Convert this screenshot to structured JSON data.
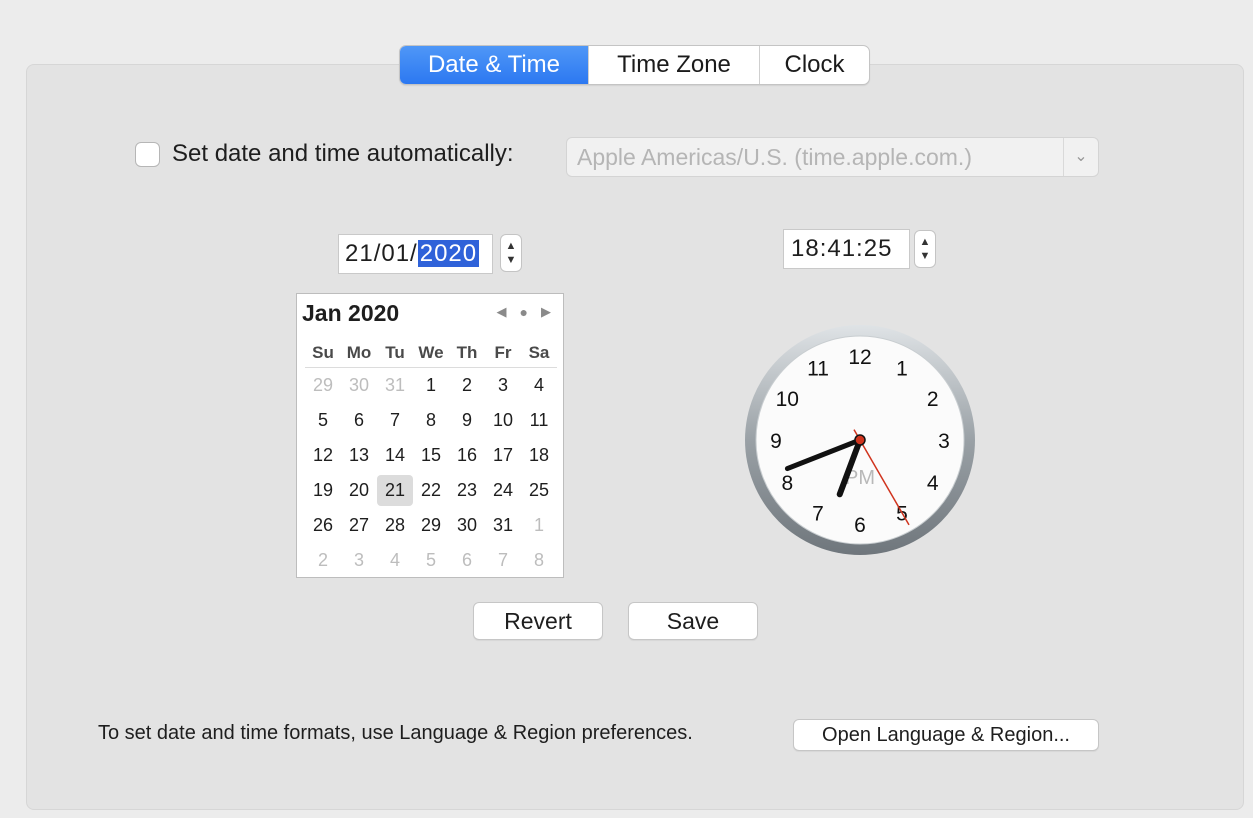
{
  "tabs": [
    {
      "label": "Date & Time",
      "active": true
    },
    {
      "label": "Time Zone",
      "active": false
    },
    {
      "label": "Clock",
      "active": false
    }
  ],
  "auto_time": {
    "checked": false,
    "label": "Set date and time automatically:",
    "server": "Apple Americas/U.S. (time.apple.com.)"
  },
  "date_field": {
    "day_month": "21/01/",
    "year": "2020"
  },
  "time_field": {
    "value": "18:41:25"
  },
  "calendar": {
    "title": "Jan 2020",
    "nav": {
      "prev": "◀",
      "today": "●",
      "next": "▶"
    },
    "weekdays": [
      "Su",
      "Mo",
      "Tu",
      "We",
      "Th",
      "Fr",
      "Sa"
    ],
    "weeks": [
      [
        {
          "d": "29",
          "o": true
        },
        {
          "d": "30",
          "o": true
        },
        {
          "d": "31",
          "o": true
        },
        {
          "d": "1"
        },
        {
          "d": "2"
        },
        {
          "d": "3"
        },
        {
          "d": "4"
        }
      ],
      [
        {
          "d": "5"
        },
        {
          "d": "6"
        },
        {
          "d": "7"
        },
        {
          "d": "8"
        },
        {
          "d": "9"
        },
        {
          "d": "10"
        },
        {
          "d": "11"
        }
      ],
      [
        {
          "d": "12"
        },
        {
          "d": "13"
        },
        {
          "d": "14"
        },
        {
          "d": "15"
        },
        {
          "d": "16"
        },
        {
          "d": "17"
        },
        {
          "d": "18"
        }
      ],
      [
        {
          "d": "19"
        },
        {
          "d": "20"
        },
        {
          "d": "21",
          "s": true
        },
        {
          "d": "22"
        },
        {
          "d": "23"
        },
        {
          "d": "24"
        },
        {
          "d": "25"
        }
      ],
      [
        {
          "d": "26"
        },
        {
          "d": "27"
        },
        {
          "d": "28"
        },
        {
          "d": "29"
        },
        {
          "d": "30"
        },
        {
          "d": "31"
        },
        {
          "d": "1",
          "o": true
        }
      ],
      [
        {
          "d": "2",
          "o": true
        },
        {
          "d": "3",
          "o": true
        },
        {
          "d": "4",
          "o": true
        },
        {
          "d": "5",
          "o": true
        },
        {
          "d": "6",
          "o": true
        },
        {
          "d": "7",
          "o": true
        },
        {
          "d": "8",
          "o": true
        }
      ]
    ]
  },
  "clock": {
    "numbers": [
      "12",
      "1",
      "2",
      "3",
      "4",
      "5",
      "6",
      "7",
      "8",
      "9",
      "10",
      "11"
    ],
    "meridiem": "PM",
    "hour": 18,
    "minute": 41,
    "second": 25
  },
  "buttons": {
    "revert": "Revert",
    "save": "Save"
  },
  "footer": {
    "text": "To set date and time formats, use Language & Region preferences.",
    "button": "Open Language & Region..."
  },
  "colors": {
    "accent": "#2f78f1",
    "selection": "#2f62d9",
    "second_hand": "#d0341e"
  },
  "icons": {
    "select_arrow": "chevron-down-icon",
    "stepper": "up-down-arrows-icon"
  }
}
